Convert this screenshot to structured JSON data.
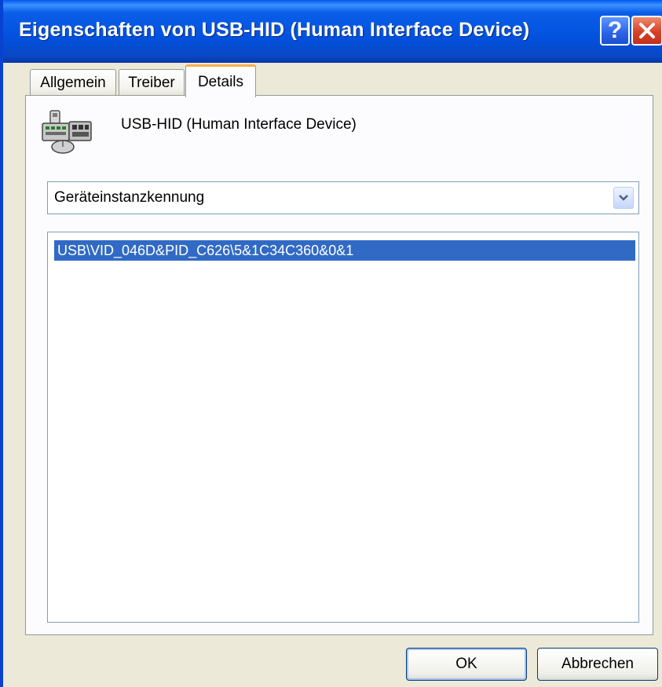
{
  "window": {
    "title": "Eigenschaften von USB-HID (Human Interface Device)",
    "help_icon": "help-icon",
    "close_icon": "close-icon"
  },
  "tabs": [
    {
      "label": "Allgemein",
      "active": false
    },
    {
      "label": "Treiber",
      "active": false
    },
    {
      "label": "Details",
      "active": true
    }
  ],
  "device": {
    "icon": "hid-device-icon",
    "name": "USB-HID (Human Interface Device)"
  },
  "property_select": {
    "value": "Geräteinstanzkennung",
    "arrow_icon": "chevron-down-icon"
  },
  "values_list": {
    "items": [
      "USB\\VID_046D&PID_C626\\5&1C34C360&0&1"
    ],
    "selected_index": 0
  },
  "buttons": {
    "ok_label": "OK",
    "cancel_label": "Abbrechen"
  },
  "colors": {
    "titlebar": "#0251de",
    "selection": "#316ac5",
    "dialog_bg": "#ece9d8",
    "active_tab_accent": "#f5b04a",
    "close_button": "#d7402a"
  }
}
